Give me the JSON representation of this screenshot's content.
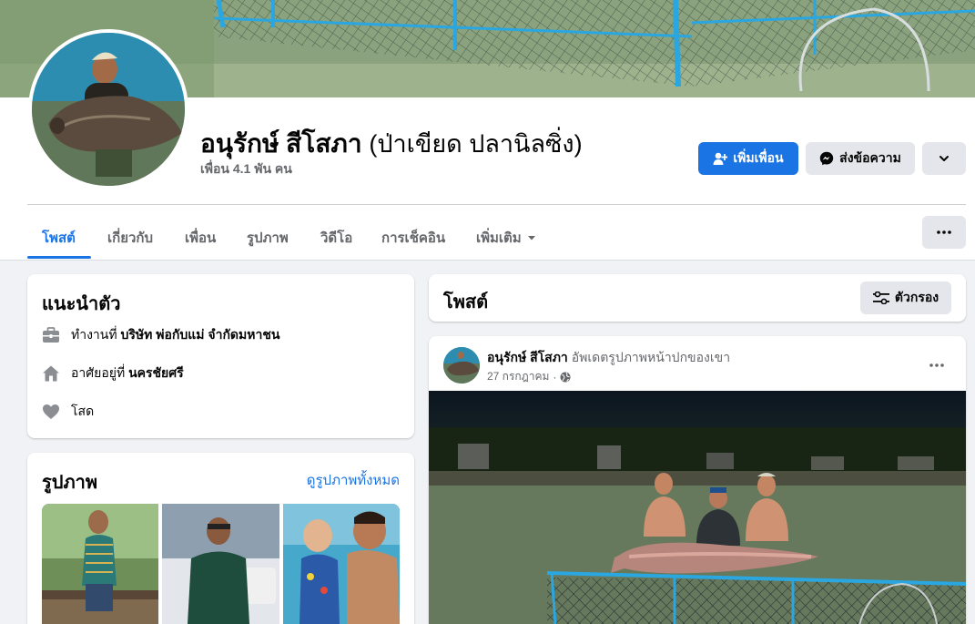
{
  "profile": {
    "name": "อนุรักษ์ สีโสภา",
    "alt_name": "(ป่าเขียด ปลานิลซิ่ง)",
    "friends": "เพื่อน 4.1 พัน คน"
  },
  "actions": {
    "add_friend": "เพิ่มเพื่อน",
    "message": "ส่งข้อความ"
  },
  "tabs": [
    {
      "label": "โพสต์",
      "active": true
    },
    {
      "label": "เกี่ยวกับ"
    },
    {
      "label": "เพื่อน"
    },
    {
      "label": "รูปภาพ"
    },
    {
      "label": "วิดีโอ"
    },
    {
      "label": "การเช็คอิน"
    },
    {
      "label": "เพิ่มเติม"
    }
  ],
  "intro": {
    "title": "แนะนำตัว",
    "work_prefix": "ทำงานที่",
    "work": "บริษัท พ่อกับแม่ จำกัดมหาชน",
    "lives_prefix": "อาศัยอยู่ที่",
    "lives": "นครชัยศรี",
    "relationship": "โสด"
  },
  "photos": {
    "title": "รูปภาพ",
    "see_all": "ดูรูปภาพทั้งหมด"
  },
  "posts_header": {
    "title": "โพสต์",
    "filter": "ตัวกรอง"
  },
  "post": {
    "author": "อนุรักษ์ สีโสภา",
    "action": "อัพเดตรูปภาพหน้าปกของเขา",
    "date": "27 กรกฎาคม"
  },
  "colors": {
    "accent": "#1b74e4",
    "secondary_text": "#65676b",
    "page_bg": "#f0f2f5"
  },
  "icons": [
    "add-friend-icon",
    "messenger-icon",
    "chevron-down-icon",
    "more-icon",
    "filter-icon",
    "briefcase-icon",
    "home-icon",
    "heart-icon",
    "globe-icon"
  ]
}
